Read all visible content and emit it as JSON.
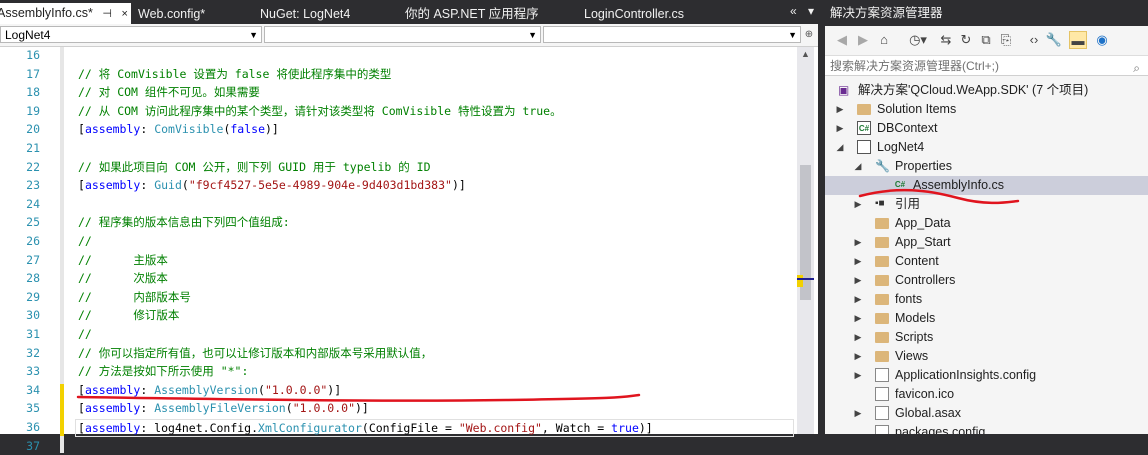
{
  "tabs": [
    {
      "label": "AssemblyInfo.cs*",
      "pin": "⊣",
      "close": "×"
    },
    {
      "label": "Web.config*"
    },
    {
      "label": "NuGet: LogNet4"
    },
    {
      "label": "你的 ASP.NET 应用程序"
    },
    {
      "label": "LoginController.cs"
    }
  ],
  "nav": {
    "project": "LogNet4",
    "type": "",
    "member": ""
  },
  "lines": [
    {
      "n": "16"
    },
    {
      "n": "17"
    },
    {
      "n": "18"
    },
    {
      "n": "19"
    },
    {
      "n": "20"
    },
    {
      "n": "21"
    },
    {
      "n": "22"
    },
    {
      "n": "23"
    },
    {
      "n": "24"
    },
    {
      "n": "25"
    },
    {
      "n": "26"
    },
    {
      "n": "27"
    },
    {
      "n": "28"
    },
    {
      "n": "29"
    },
    {
      "n": "30"
    },
    {
      "n": "31"
    },
    {
      "n": "32"
    },
    {
      "n": "33"
    },
    {
      "n": "34"
    },
    {
      "n": "35"
    },
    {
      "n": "36"
    },
    {
      "n": "37"
    }
  ],
  "code": {
    "l17": "// 将 ComVisible 设置为 false 将使此程序集中的类型",
    "l18": "// 对 COM 组件不可见。如果需要",
    "l19": "// 从 COM 访问此程序集中的某个类型，请针对该类型将 ComVisible 特性设置为 true。",
    "l20a": "[",
    "l20b": "assembly",
    "l20c": ": ",
    "l20d": "ComVisible",
    "l20e": "(",
    "l20f": "false",
    "l20g": ")]",
    "l22": "// 如果此项目向 COM 公开，则下列 GUID 用于 typelib 的 ID",
    "l23a": "[",
    "l23b": "assembly",
    "l23c": ": ",
    "l23d": "Guid",
    "l23e": "(",
    "l23f": "\"f9cf4527-5e5e-4989-904e-9d403d1bd383\"",
    "l23g": ")]",
    "l25": "// 程序集的版本信息由下列四个值组成:",
    "l26": "//",
    "l27": "//      主版本",
    "l28": "//      次版本",
    "l29": "//      内部版本号",
    "l30": "//      修订版本",
    "l31": "//",
    "l32": "// 你可以指定所有值，也可以让修订版本和内部版本号采用默认值，",
    "l33": "// 方法是按如下所示使用 \"*\":",
    "l34a": "[",
    "l34b": "assembly",
    "l34c": ": ",
    "l34d": "AssemblyVersion",
    "l34e": "(",
    "l34f": "\"1.0.0.0\"",
    "l34g": ")]",
    "l35a": "[",
    "l35b": "assembly",
    "l35c": ": ",
    "l35d": "AssemblyFileVersion",
    "l35e": "(",
    "l35f": "\"1.0.0.0\"",
    "l35g": ")]",
    "l36a": "[",
    "l36b": "assembly",
    "l36c": ": log4net.Config.",
    "l36d": "XmlConfigurator",
    "l36e": "(ConfigFile = ",
    "l36f": "\"Web.config\"",
    "l36g": ", Watch = ",
    "l36h": "true",
    "l36i": ")]"
  },
  "solution": {
    "title": "解决方案资源管理器",
    "search_placeholder": "搜索解决方案资源管理器(Ctrl+;)",
    "items": [
      {
        "label": "解决方案'QCloud.WeApp.SDK' (7 个项目)"
      },
      {
        "label": "Solution Items"
      },
      {
        "label": "DBContext"
      },
      {
        "label": "LogNet4"
      },
      {
        "label": "Properties"
      },
      {
        "label": "AssemblyInfo.cs"
      },
      {
        "label": "引用"
      },
      {
        "label": "App_Data"
      },
      {
        "label": "App_Start"
      },
      {
        "label": "Content"
      },
      {
        "label": "Controllers"
      },
      {
        "label": "fonts"
      },
      {
        "label": "Models"
      },
      {
        "label": "Scripts"
      },
      {
        "label": "Views"
      },
      {
        "label": "ApplicationInsights.config"
      },
      {
        "label": "favicon.ico"
      },
      {
        "label": "Global.asax"
      },
      {
        "label": "packages.config"
      }
    ]
  },
  "colors": {
    "accent": "#2d2d30",
    "comment": "#008000",
    "keyword": "#0000ff",
    "type": "#2b91af",
    "string": "#a31515",
    "annotation": "#e0141e"
  }
}
